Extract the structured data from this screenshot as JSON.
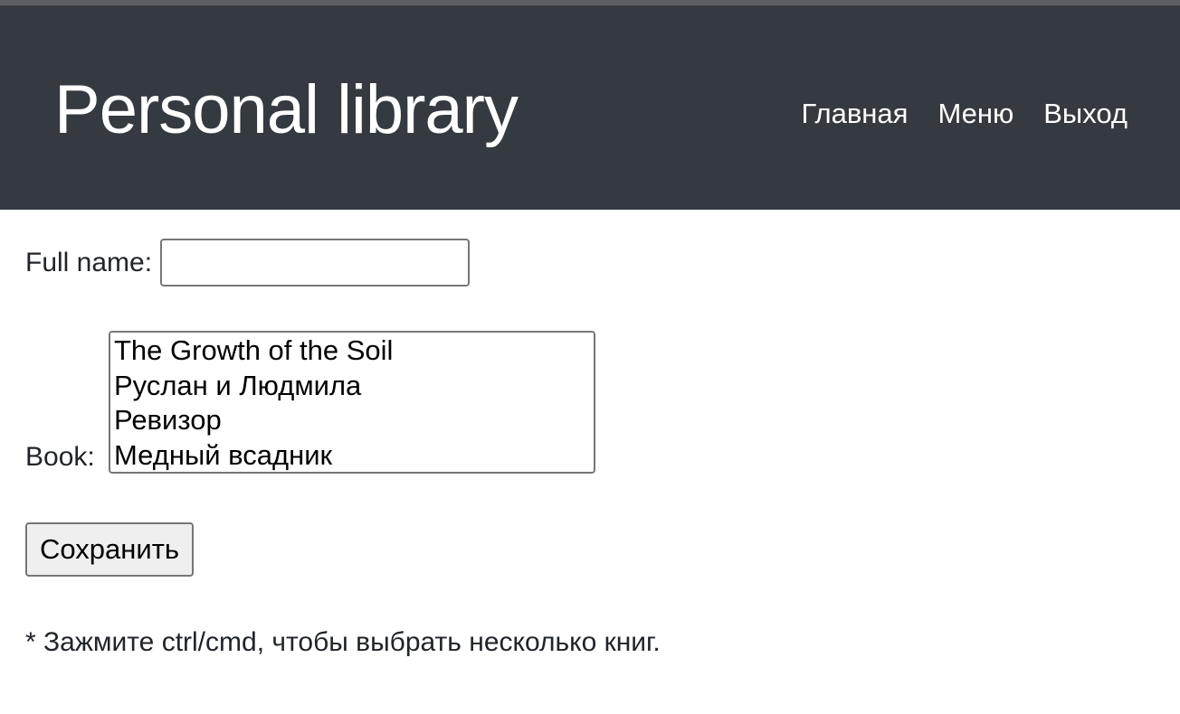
{
  "header": {
    "brand": "Personal library",
    "nav": [
      "Главная",
      "Меню",
      "Выход"
    ]
  },
  "form": {
    "full_name_label": "Full name:",
    "full_name_value": "",
    "book_label": "Book:",
    "books": [
      "The Growth of the Soil",
      "Руслан и Людмила",
      "Ревизор",
      "Медный всадник"
    ],
    "save_label": "Сохранить",
    "hint": "* Зажмите ctrl/cmd, чтобы выбрать несколько книг."
  },
  "colors": {
    "header_bg": "#353a41",
    "header_text": "#ffffff",
    "button_bg": "#efefef"
  }
}
